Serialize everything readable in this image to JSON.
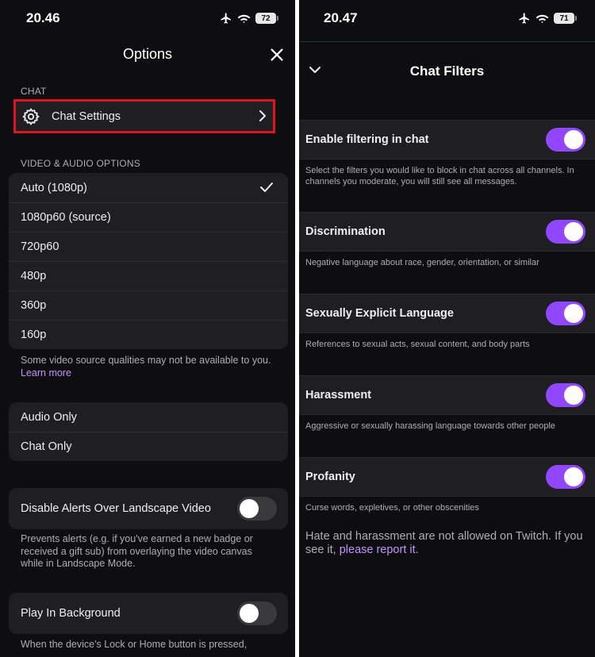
{
  "left_phone": {
    "status_bar": {
      "time": "20.46",
      "battery": "72"
    },
    "header": {
      "title": "Options"
    },
    "chat_section": {
      "label": "CHAT",
      "chat_settings_label": "Chat Settings"
    },
    "video_section": {
      "label": "VIDEO & AUDIO OPTIONS",
      "qualities": [
        "Auto (1080p)",
        "1080p60 (source)",
        "720p60",
        "480p",
        "360p",
        "160p"
      ],
      "selected_index": 0,
      "note": "Some video source qualities may not be available to you.",
      "learn_more": "Learn more"
    },
    "modes": [
      "Audio Only",
      "Chat Only"
    ],
    "disable_alerts": {
      "label": "Disable Alerts Over Landscape Video",
      "on": false,
      "description": "Prevents alerts (e.g. if you've earned a new badge or received a gift sub) from overlaying the video canvas while in Landscape Mode."
    },
    "play_background": {
      "label": "Play In Background",
      "on": false,
      "description": "When the device's Lock or Home button is pressed,"
    }
  },
  "right_phone": {
    "status_bar": {
      "time": "20.47",
      "battery": "71"
    },
    "header": {
      "title": "Chat Filters"
    },
    "enable_filtering": {
      "label": "Enable filtering in chat",
      "on": true,
      "description": "Select the filters you would like to block in chat across all channels. In channels you moderate, you will still see all messages."
    },
    "filters": [
      {
        "label": "Discrimination",
        "on": true,
        "description": "Negative language about race, gender, orientation, or similar"
      },
      {
        "label": "Sexually Explicit Language",
        "on": true,
        "description": "References to sexual acts, sexual content, and body parts"
      },
      {
        "label": "Harassment",
        "on": true,
        "description": "Aggressive or sexually harassing language towards other people"
      },
      {
        "label": "Profanity",
        "on": true,
        "description": "Curse words, expletives, or other obscenities"
      }
    ],
    "footer": {
      "text": "Hate and harassment are not allowed on Twitch. If you see it,",
      "link": "please report it",
      "end": "."
    }
  },
  "colors": {
    "background": "#0e0e10",
    "surface": "#1f1f23",
    "accent_purple": "#9147ff",
    "link_purple": "#bf94ff",
    "highlight_red": "#e0141e",
    "muted_text": "#adadb8"
  },
  "icons": [
    "airplane-icon",
    "wifi-icon",
    "battery-icon",
    "close-icon",
    "gear-icon",
    "chevron-right-icon",
    "checkmark-icon",
    "chevron-down-icon"
  ]
}
